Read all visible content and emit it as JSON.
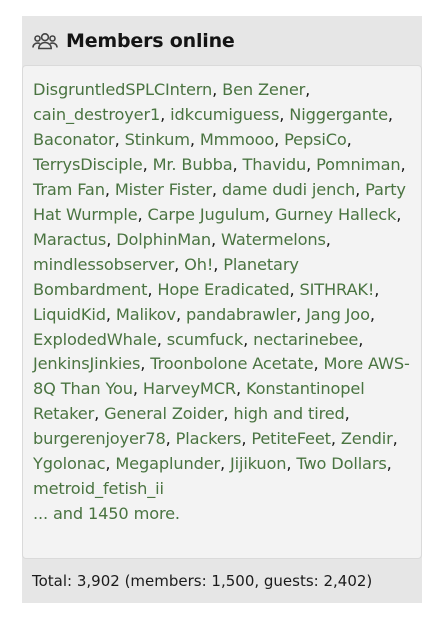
{
  "widget": {
    "title": "Members online",
    "icon": "users-icon",
    "members": [
      "DisgruntledSPLCIntern",
      "Ben Zener",
      "cain_destroyer1",
      "idkcumiguess",
      "Niggergante",
      "Baconator",
      "Stinkum",
      "Mmmooo",
      "PepsiCo",
      "TerrysDisciple",
      "Mr. Bubba",
      "Thavidu",
      "Pomniman",
      "Tram Fan",
      "Mister Fister",
      "dame dudi jench",
      "Party Hat Wurmple",
      "Carpe Jugulum",
      "Gurney Halleck",
      "Maractus",
      "DolphinMan",
      "Watermelons",
      "mindlessobserver",
      "Oh!",
      "Planetary Bombardment",
      "Hope Eradicated",
      "SITHRAK!",
      "LiquidKid",
      "Malikov",
      "pandabrawler",
      "Jang Joo",
      "ExplodedWhale",
      "scumfuck",
      "nectarinebee",
      "JenkinsJinkies",
      "Troonbolone Acetate",
      "More AWS-8Q Than You",
      "HarveyMCR",
      "Konstantinopel Retaker",
      "General Zoider",
      "high and tired",
      "burgerenjoyer78",
      "Plackers",
      "PetiteFeet",
      "Zendir",
      "Ygolonac",
      "Megaplunder",
      "Jijikuon",
      "Two Dollars",
      "metroid_fetish_ii"
    ],
    "more_text": "... and 1450 more.",
    "footer": "Total: 3,902 (members: 1,500, guests: 2,402)",
    "colors": {
      "link": "#4a7441",
      "panel": "#e6e6e6",
      "body": "#f3f3f3"
    }
  }
}
